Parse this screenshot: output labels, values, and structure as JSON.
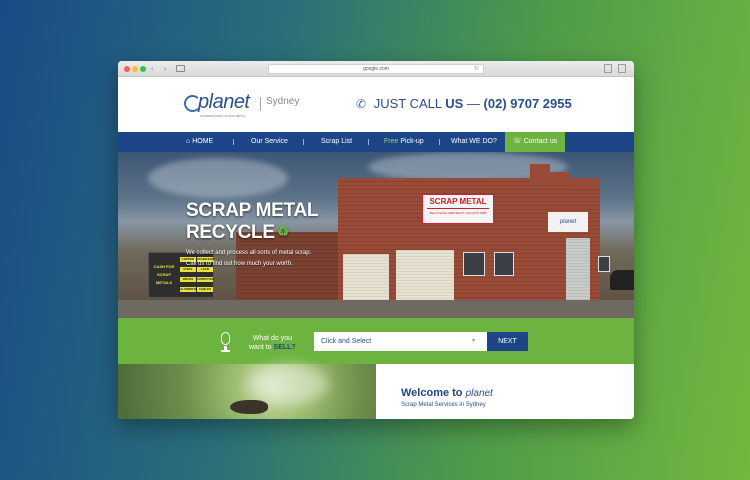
{
  "browser": {
    "url": "google.com",
    "nav_arrows": "‹ ›",
    "reload_icon": "↻"
  },
  "site": {
    "logo_text": "planet",
    "logo_tagline": "INTERNATIONAL SCRAP METAL",
    "city": "Sydney",
    "phone_lead": "JUST CALL",
    "phone_us": "US",
    "phone_dash": "—",
    "phone_number": "(02) 9707 2955"
  },
  "nav": {
    "home_icon": "⌂",
    "home": "HOME",
    "sep": "|",
    "service": "Our Service",
    "scrap_list": "Scrap List",
    "free": "Free",
    "pickup": "Pick-up",
    "what": "What WE DO?",
    "contact_icon": "☏",
    "contact": "Contact us"
  },
  "hero": {
    "title_line1": "SCRAP METAL",
    "title_line2": "RECYCLE",
    "recycle_icon": "♻",
    "text_line1": "We collect and process all sorts of metal scrap.",
    "text_line2": "Call us to find out how much your worth.",
    "sign_title": "SCRAP METAL",
    "sign_sub": "RECYCLING CENTRE  Ph: (02) 9707 2955",
    "building_logo": "planet",
    "board": [
      "COPPER",
      "STAINLESS",
      "STEEL",
      "LEAD",
      "BRASS",
      "COMPUTER",
      "ALUMINIUM",
      "CABLES"
    ],
    "board_main": [
      "CASH FOR",
      "SCRAP",
      "METALS"
    ]
  },
  "select": {
    "ask_line1": "What do you",
    "ask_line2_a": "want to",
    "ask_line2_b": "SELL?",
    "dropdown_value": "Click and Select",
    "caret": "▾",
    "next": "NEXT"
  },
  "welcome": {
    "title": "Welcome to",
    "logo": "planet",
    "subtitle": "Scrap Metal Services in Sydney"
  },
  "colors": {
    "brand_blue": "#1d4688",
    "brand_green": "#6db33f"
  }
}
